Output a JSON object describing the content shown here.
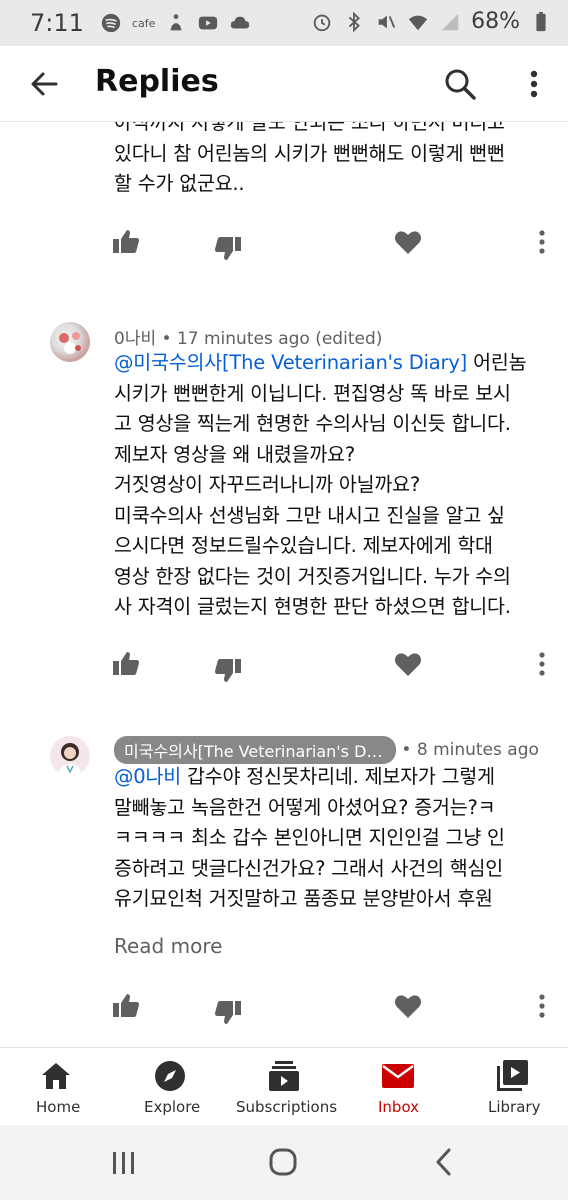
{
  "status_bar": {
    "time": "7:11",
    "cafe_label": "cafe",
    "battery": "68%"
  },
  "app_bar": {
    "title": "Replies",
    "back_icon": "arrow-left-icon",
    "search_icon": "search-icon",
    "more_icon": "more-vert-icon"
  },
  "comments": [
    {
      "text": "아직까지 저렇게 말도 안되는 소리 하면서 버티고\n있다니 참 어린놈의 시키가 뻔뻔해도 이렇게 뻔뻔\n할 수가 없군요.."
    },
    {
      "author": "0나비",
      "time": "17 minutes ago (edited)",
      "separator": "•",
      "mention": "@미국수의사[The Veterinarian's Diary]",
      "text": " 어린놈\n시키가 뻔뻔한게 이닙니다. 편집영상 똑 바로 보시\n고 영상을 찍는게 현명한 수의사님 이신듯 합니다.\n제보자 영상을 왜 내렸을까요?\n거짓영상이 자꾸드러나니까 아닐까요?\n미쿡수의사 선생님화 그만 내시고 진실을 알고 싶\n으시다면 정보드릴수있습니다. 제보자에게 학대\n영상 한장 없다는 것이 거짓증거입니다. 누가 수의\n사 자격이 글렀는지 현명한 판단 하셨으면 합니다."
    },
    {
      "author": "미국수의사[The Veterinarian's Diary]",
      "time": "8 minutes ago",
      "separator": "•",
      "mention": "@0나비",
      "text": " 갑수야 정신못차리네.  제보자가 그렇게\n말빼놓고 녹음한건 어떻게 아셨어요? 증거는?ㅋ\nㅋㅋㅋㅋ 최소 갑수 본인아니면 지인인걸 그냥 인\n증하려고 댓글다신건가요? 그래서 사건의 핵심인\n유기묘인척 거짓말하고 품종묘 분양받아서 후원",
      "read_more": "Read more"
    }
  ],
  "bottom_nav": [
    {
      "label": "Home",
      "icon": "home-icon"
    },
    {
      "label": "Explore",
      "icon": "compass-icon"
    },
    {
      "label": "Subscriptions",
      "icon": "subscriptions-icon"
    },
    {
      "label": "Inbox",
      "icon": "inbox-icon",
      "active": true
    },
    {
      "label": "Library",
      "icon": "library-icon"
    }
  ],
  "colors": {
    "active_nav": "#cc0000",
    "mention": "#065fd4",
    "meta": "#606060",
    "status_bar_bg": "#e9e9e9"
  }
}
